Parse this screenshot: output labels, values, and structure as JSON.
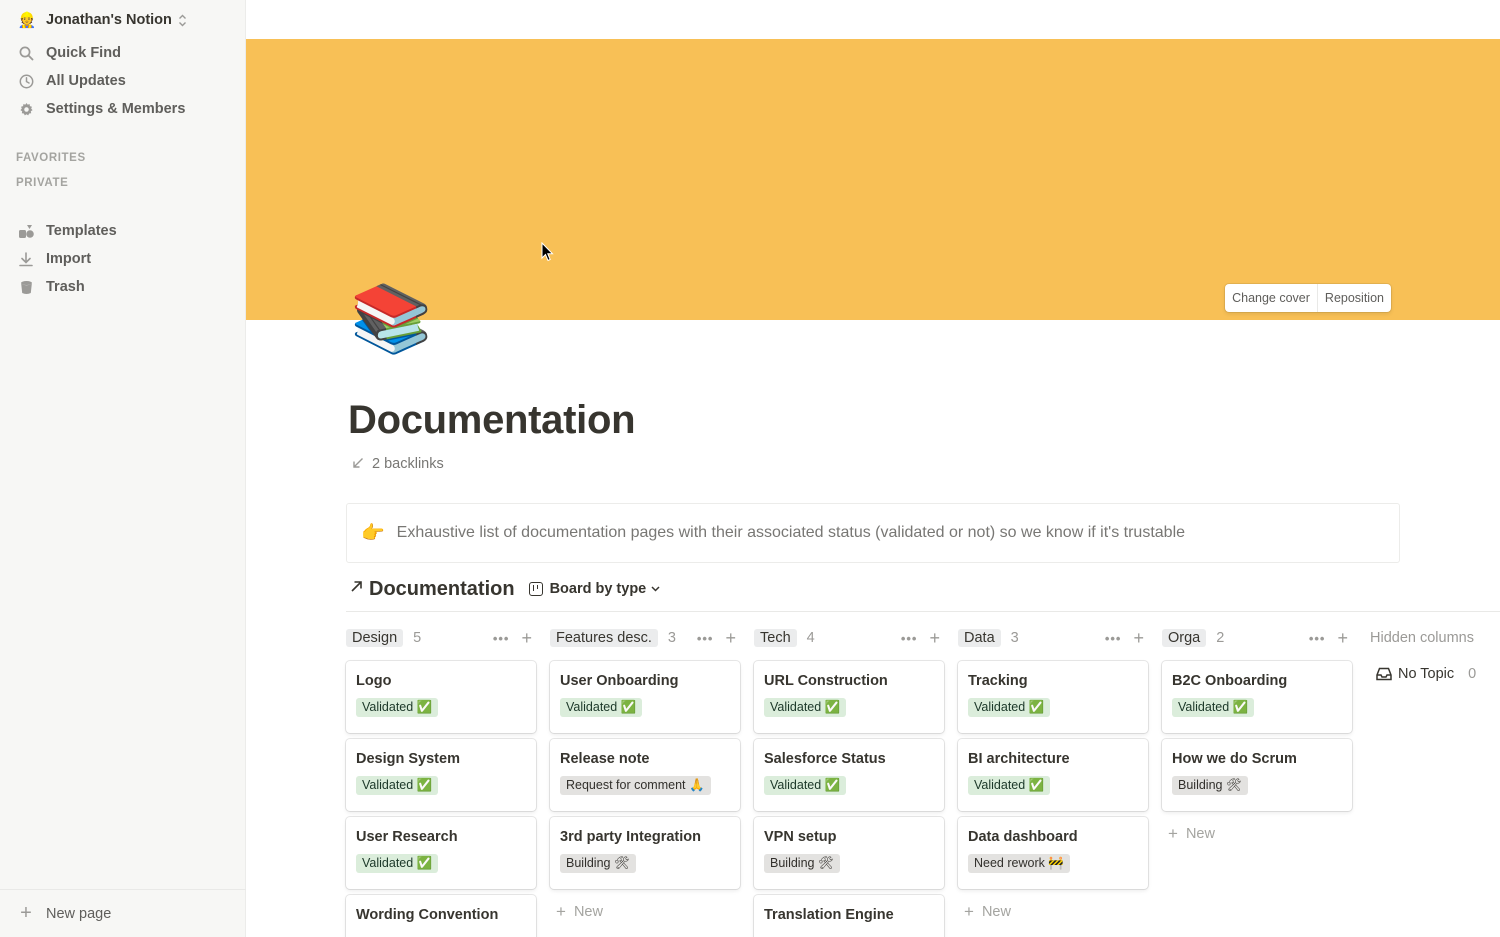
{
  "sidebar": {
    "workspace": {
      "icon": "👷",
      "name": "Jonathan's Notion"
    },
    "nav": [
      {
        "icon": "search-icon",
        "label": "Quick Find"
      },
      {
        "icon": "clock-icon",
        "label": "All Updates"
      },
      {
        "icon": "gear-icon",
        "label": "Settings & Members"
      }
    ],
    "sections": {
      "favorites": "FAVORITES",
      "private": "PRIVATE"
    },
    "utilities": [
      {
        "icon": "templates-icon",
        "label": "Templates"
      },
      {
        "icon": "download-icon",
        "label": "Import"
      },
      {
        "icon": "trash-icon",
        "label": "Trash"
      }
    ],
    "new_page": "New page"
  },
  "cover": {
    "color": "#f8c056",
    "change_label": "Change cover",
    "reposition_label": "Reposition"
  },
  "page": {
    "emoji": "📚",
    "title": "Documentation",
    "backlinks": "2 backlinks",
    "callout": {
      "icon": "👉",
      "text": "Exhaustive list of documentation pages with their associated status (validated or not) so we know if it's trustable"
    }
  },
  "database": {
    "title": "Documentation",
    "view": "Board by type",
    "columns": [
      {
        "name": "Design",
        "count": "5",
        "cards": [
          {
            "title": "Logo",
            "status": "Validated ✅",
            "tone": "green"
          },
          {
            "title": "Design System",
            "status": "Validated ✅",
            "tone": "green"
          },
          {
            "title": "User Research",
            "status": "Validated ✅",
            "tone": "green"
          },
          {
            "title": "Wording Convention",
            "status": "",
            "tone": "green"
          }
        ],
        "new": ""
      },
      {
        "name": "Features desc.",
        "count": "3",
        "cards": [
          {
            "title": "User Onboarding",
            "status": "Validated ✅",
            "tone": "green"
          },
          {
            "title": "Release note",
            "status": "Request for comment 🙏",
            "tone": "grey"
          },
          {
            "title": "3rd party Integration",
            "status": "Building 🛠",
            "tone": "grey"
          }
        ],
        "new": "New"
      },
      {
        "name": "Tech",
        "count": "4",
        "cards": [
          {
            "title": "URL Construction",
            "status": "Validated ✅",
            "tone": "green"
          },
          {
            "title": "Salesforce Status",
            "status": "Validated ✅",
            "tone": "green"
          },
          {
            "title": "VPN setup",
            "status": "Building 🛠",
            "tone": "grey"
          },
          {
            "title": "Translation Engine",
            "status": "",
            "tone": "grey"
          }
        ],
        "new": ""
      },
      {
        "name": "Data",
        "count": "3",
        "cards": [
          {
            "title": "Tracking",
            "status": "Validated ✅",
            "tone": "green"
          },
          {
            "title": "BI architecture",
            "status": "Validated ✅",
            "tone": "green"
          },
          {
            "title": "Data dashboard",
            "status": "Need rework 🚧",
            "tone": "grey"
          }
        ],
        "new": "New"
      },
      {
        "name": "Orga",
        "count": "2",
        "cards": [
          {
            "title": "B2C Onboarding",
            "status": "Validated ✅",
            "tone": "green"
          },
          {
            "title": "How we do Scrum",
            "status": "Building 🛠",
            "tone": "grey"
          }
        ],
        "new": "New"
      }
    ],
    "hidden": {
      "label": "Hidden columns",
      "no_topic": "No Topic",
      "no_topic_count": "0"
    }
  }
}
